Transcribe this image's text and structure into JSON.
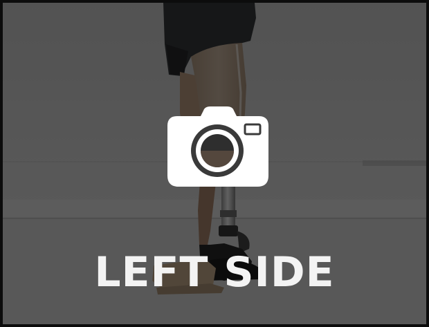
{
  "tile": {
    "label": "LEFT SIDE",
    "icon": "camera-icon",
    "image_subject": "prosthetic-leg-photo"
  },
  "colors": {
    "overlay": "#000000",
    "text": "#f3f3f3",
    "icon": "#ffffff",
    "border": "#0c0c0c"
  }
}
